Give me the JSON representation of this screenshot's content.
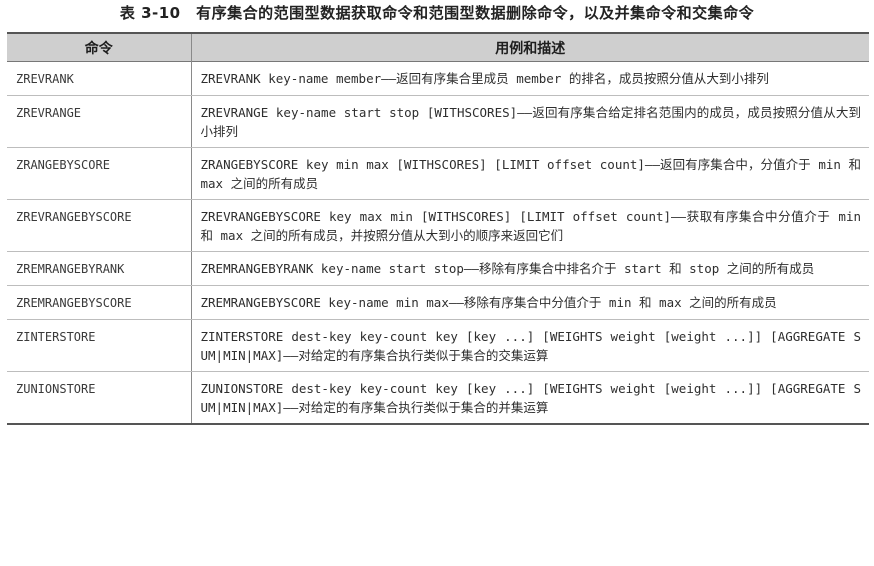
{
  "caption": "表 3-10　有序集合的范围型数据获取命令和范围型数据删除命令，以及并集命令和交集命令",
  "table": {
    "headers": [
      "命令",
      "用例和描述"
    ],
    "rows": [
      {
        "command": "ZREVRANK",
        "description": "ZREVRANK key-name member——返回有序集合里成员 member 的排名，成员按照分值从大到小排列"
      },
      {
        "command": "ZREVRANGE",
        "description": "ZREVRANGE key-name start stop [WITHSCORES]——返回有序集合给定排名范围内的成员，成员按照分值从大到小排列"
      },
      {
        "command": "ZRANGEBYSCORE",
        "description": "ZRANGEBYSCORE key min max [WITHSCORES] [LIMIT offset count]——返回有序集合中，分值介于 min 和 max 之间的所有成员"
      },
      {
        "command": "ZREVRANGEBYSCORE",
        "description": "ZREVRANGEBYSCORE key max min [WITHSCORES] [LIMIT offset count]——获取有序集合中分值介于 min 和 max 之间的所有成员，并按照分值从大到小的顺序来返回它们"
      },
      {
        "command": "ZREMRANGEBYRANK",
        "description": "ZREMRANGEBYRANK key-name start stop——移除有序集合中排名介于 start 和 stop 之间的所有成员"
      },
      {
        "command": "ZREMRANGEBYSCORE",
        "description": "ZREMRANGEBYSCORE key-name min max——移除有序集合中分值介于 min 和 max 之间的所有成员"
      },
      {
        "command": "ZINTERSTORE",
        "description": "ZINTERSTORE dest-key key-count key [key ...] [WEIGHTS weight [weight ...]] [AGGREGATE SUM|MIN|MAX]——对给定的有序集合执行类似于集合的交集运算"
      },
      {
        "command": "ZUNIONSTORE",
        "description": "ZUNIONSTORE dest-key key-count key [key ...] [WEIGHTS weight [weight ...]] [AGGREGATE SUM|MIN|MAX]——对给定的有序集合执行类似于集合的并集运算"
      }
    ]
  }
}
